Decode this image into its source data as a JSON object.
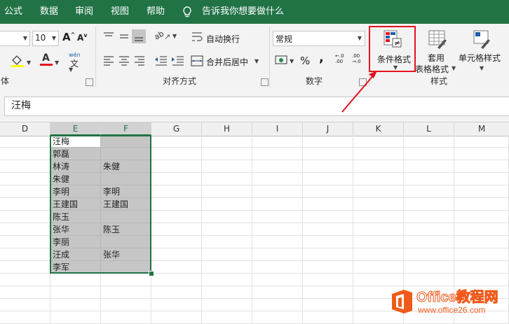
{
  "menu": [
    "公式",
    "数据",
    "审阅",
    "视图",
    "帮助"
  ],
  "tell_me": "告诉我你想要做什么",
  "font": {
    "size": "10",
    "group_label": "体"
  },
  "alignment": {
    "wrap_text": "自动换行",
    "merge_center": "合并后居中",
    "group_label": "对齐方式",
    "orientation_glyph": "ab",
    "phonetic_glyph": "wén",
    "phonetic_glyph2": "文"
  },
  "number": {
    "format": "常规",
    "percent": "%",
    "comma": ",",
    "inc_decimal": "←.0\n.00",
    "dec_decimal": ".00\n→.0",
    "group_label": "数字"
  },
  "styles": {
    "conditional": "条件格式",
    "table_line1": "套用",
    "table_line2": "表格格式",
    "cell_styles": "单元格样式",
    "group_label": "样式"
  },
  "formula_bar": {
    "value": "汪梅"
  },
  "columns": [
    "D",
    "E",
    "F",
    "G",
    "H",
    "I",
    "J",
    "K",
    "L",
    "M"
  ],
  "column_e": [
    "汪梅",
    "郭磊",
    "林涛",
    "朱健",
    "李明",
    "王建国",
    "陈玉",
    "张华",
    "李丽",
    "汪成",
    "李军"
  ],
  "column_f": [
    "",
    "",
    "朱健",
    "",
    "李明",
    "王建国",
    "",
    "陈玉",
    "",
    "张华",
    ""
  ],
  "watermark": {
    "title": "Office教程网",
    "url": "www.office26.com"
  },
  "colors": {
    "excel_green": "#217346",
    "highlight_red": "#e2141e",
    "selection_gray": "#c6c6c6",
    "logo_orange": "#f05a1a"
  }
}
